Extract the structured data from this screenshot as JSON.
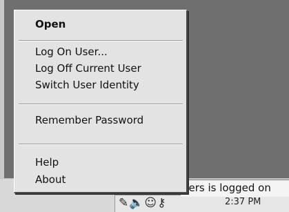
{
  "menu": {
    "items": [
      {
        "label": "Open"
      },
      {
        "label": "Log On User..."
      },
      {
        "label": "Log Off Current User"
      },
      {
        "label": "Switch User Identity"
      },
      {
        "label": "Remember Password"
      },
      {
        "label": "Help"
      },
      {
        "label": "About"
      }
    ]
  },
  "tray": {
    "balloon_text": "ders is logged on",
    "clock": "2:37 PM",
    "icons": [
      "pencil-icon",
      "speaker-icon",
      "user-icon",
      "key-icon"
    ]
  }
}
